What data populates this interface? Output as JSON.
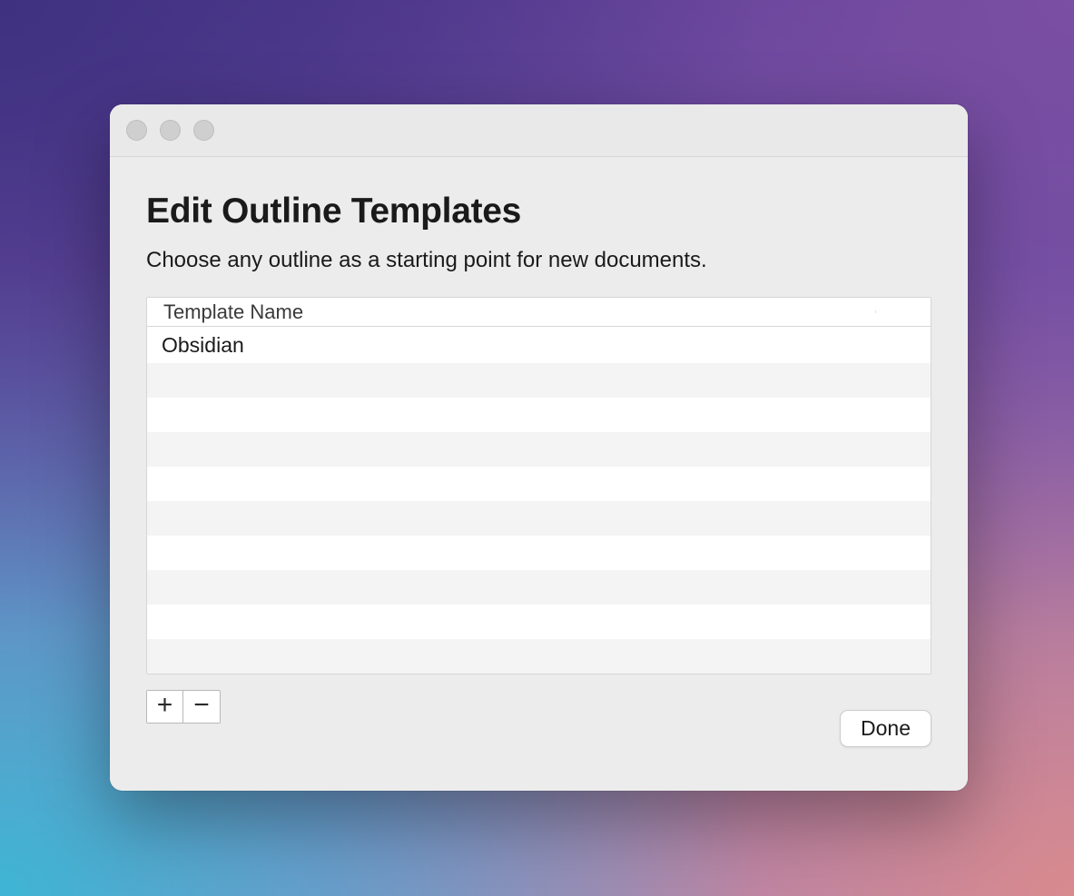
{
  "dialog": {
    "title": "Edit Outline Templates",
    "subtitle": "Choose any outline as a starting point for new documents.",
    "table": {
      "header": "Template Name",
      "rows": [
        "Obsidian"
      ],
      "empty_rows": 9
    },
    "buttons": {
      "add_label": "+",
      "remove_label": "−",
      "done_label": "Done"
    }
  }
}
